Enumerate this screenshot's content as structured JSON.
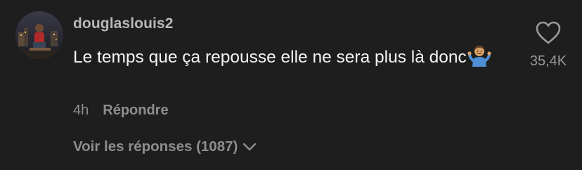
{
  "comment": {
    "username": "douglaslouis2",
    "text": "Le temps que ça repousse elle ne sera plus là donc",
    "time": "4h",
    "reply_label": "Répondre",
    "likes": "35,4K",
    "view_replies_label": "Voir les réponses (1087)"
  },
  "icons": {
    "like": "heart-outline-icon",
    "emoji": "man-shrugging-emoji",
    "expand": "chevron-down-icon"
  },
  "colors": {
    "background": "#1e1e1e",
    "username": "#b8b8b8",
    "body_text": "#f4f4f4",
    "secondary": "#8e8e8e"
  }
}
